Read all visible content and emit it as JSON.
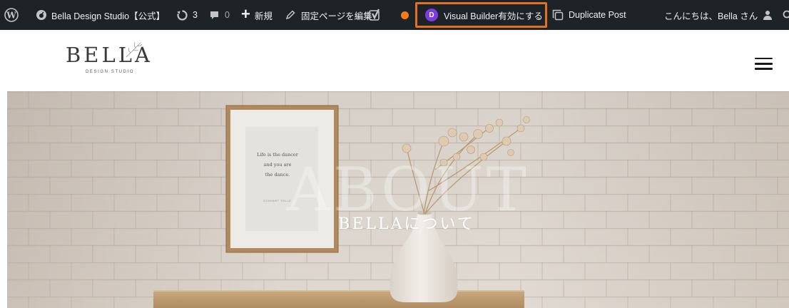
{
  "admin_bar": {
    "site_name": "Bella Design Studio【公式】",
    "updates_count": "3",
    "comments_count": "0",
    "new_label": "新規",
    "edit_page_label": "固定ページを編集",
    "visual_builder_badge": "D",
    "visual_builder_label": "Visual Builder有効にする",
    "duplicate_post_label": "Duplicate Post",
    "greeting": "こんにちは、Bella さん",
    "icons": [
      "wordpress-icon",
      "dashboard-icon",
      "updates-icon",
      "comment-icon",
      "plus-icon",
      "pencil-icon",
      "yoast-icon",
      "divi-icon",
      "duplicate-icon",
      "user-icon",
      "search-icon"
    ],
    "highlight_color": "#e4711d",
    "divi_color": "#7d3be0",
    "status_dot_color": "#f77b1b"
  },
  "site_header": {
    "logo_text": "BELLA",
    "logo_subtext": "DESIGN STUDIO",
    "menu_icon": "hamburger-icon"
  },
  "hero": {
    "ghost_text": "ABOUT",
    "title": "BELLAについて",
    "frame_lines": [
      "Life is the dancer",
      "and you are",
      "the dance."
    ],
    "frame_signature": "ECKHART TOLLE"
  }
}
